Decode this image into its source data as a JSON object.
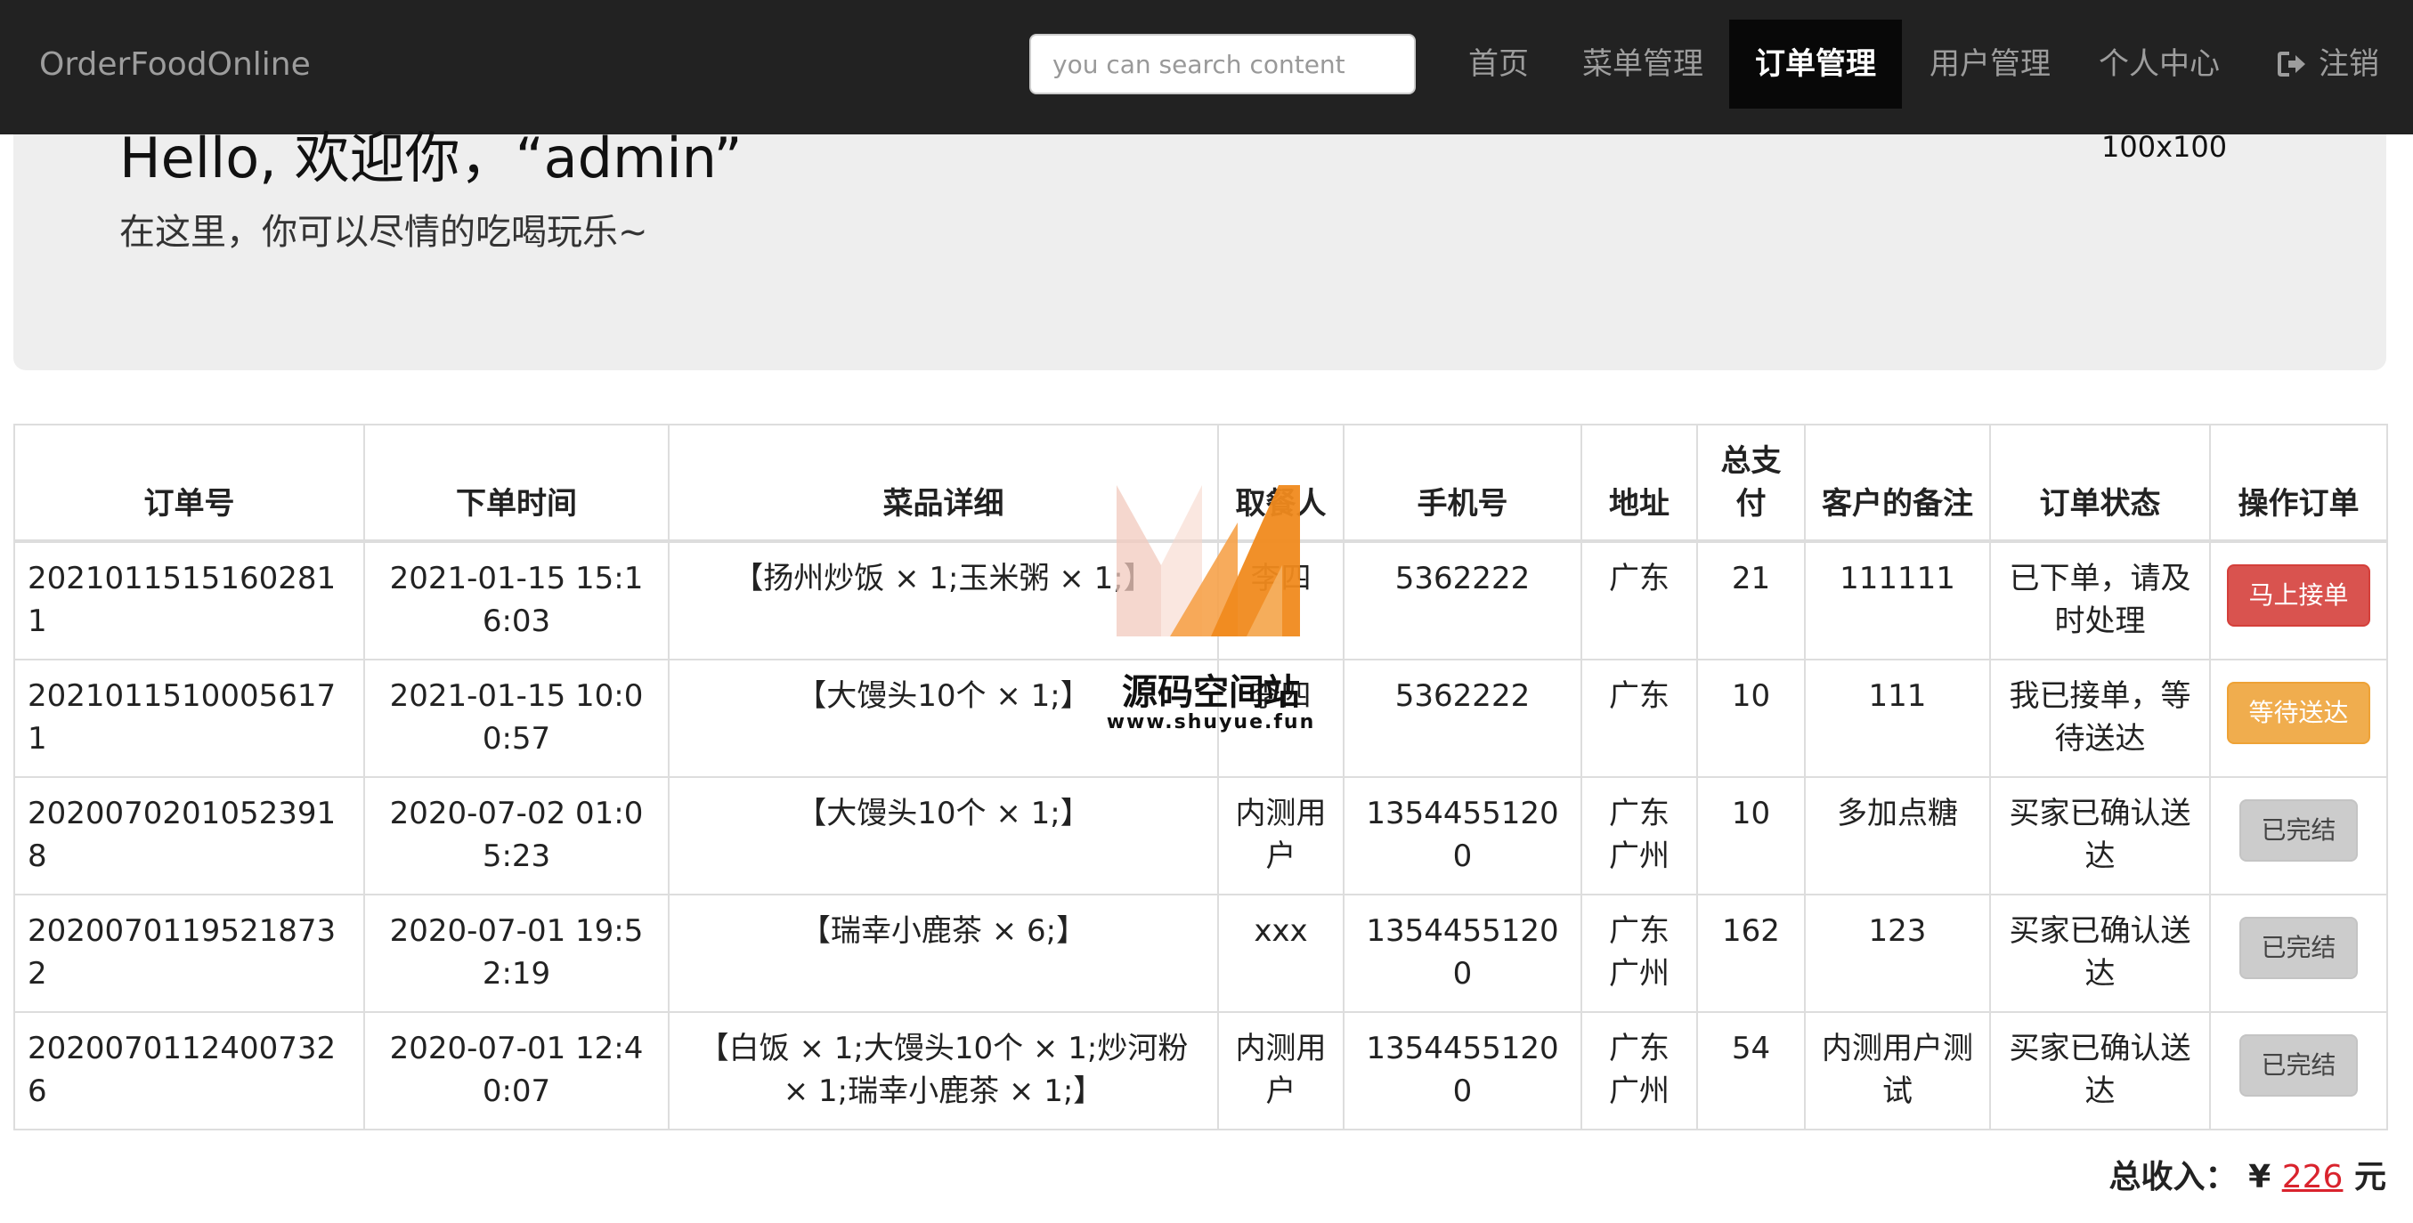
{
  "navbar": {
    "brand": "OrderFoodOnline",
    "search_placeholder": "you can search content",
    "items": [
      {
        "label": "首页"
      },
      {
        "label": "菜单管理"
      },
      {
        "label": "订单管理"
      },
      {
        "label": "用户管理"
      },
      {
        "label": "个人中心"
      },
      {
        "label": "注销"
      }
    ],
    "active": "订单管理",
    "logout_icon": "sign-out-icon"
  },
  "jumbotron": {
    "greeting": "Hello, 欢迎你，“admin”",
    "subtitle": "在这里，你可以尽情的吃喝玩乐~",
    "image_placeholder": "100x100"
  },
  "table": {
    "headers": [
      "订单号",
      "下单时间",
      "菜品详细",
      "取餐人",
      "手机号",
      "地址",
      "总支付",
      "客户的备注",
      "订单状态",
      "操作订单"
    ],
    "rows": [
      {
        "order_no": "20210115151602811",
        "time": "2021-01-15 15:16:03",
        "details": "【扬州炒饭 × 1;玉米粥 × 1;】",
        "receiver": "李四",
        "phone": "5362222",
        "address": "广东",
        "total": "21",
        "note": "111111",
        "status": "已下单，请及时处理",
        "action": "马上接单",
        "action_style": "danger"
      },
      {
        "order_no": "20210115100056171",
        "time": "2021-01-15 10:00:57",
        "details": "【大馒头10个 × 1;】",
        "receiver": "李四",
        "phone": "5362222",
        "address": "广东",
        "total": "10",
        "note": "111",
        "status": "我已接单，等待送达",
        "action": "等待送达",
        "action_style": "warning"
      },
      {
        "order_no": "20200702010523918",
        "time": "2020-07-02 01:05:23",
        "details": "【大馒头10个 × 1;】",
        "receiver": "内测用户",
        "phone": "13544551200",
        "address": "广东广州",
        "total": "10",
        "note": "多加点糖",
        "status": "买家已确认送达",
        "action": "已完结",
        "action_style": "default"
      },
      {
        "order_no": "20200701195218732",
        "time": "2020-07-01 19:52:19",
        "details": "【瑞幸小鹿茶 × 6;】",
        "receiver": "xxx",
        "phone": "13544551200",
        "address": "广东广州",
        "total": "162",
        "note": "123",
        "status": "买家已确认送达",
        "action": "已完结",
        "action_style": "default"
      },
      {
        "order_no": "20200701124007326",
        "time": "2020-07-01 12:40:07",
        "details": "【白饭 × 1;大馒头10个 × 1;炒河粉 × 1;瑞幸小鹿茶 × 1;】",
        "receiver": "内测用户",
        "phone": "13544551200",
        "address": "广东广州",
        "total": "54",
        "note": "内测用户测试",
        "status": "买家已确认送达",
        "action": "已完结",
        "action_style": "default"
      }
    ]
  },
  "summary": {
    "label": "总收入：",
    "currency": "¥",
    "amount": "226",
    "unit": "元"
  },
  "watermark": {
    "title": "源码空间站",
    "url": "www.shuyue.fun"
  },
  "colors": {
    "navbar_bg": "#222222",
    "nav_active_bg": "#080808",
    "jumbotron_bg": "#eeeeee",
    "danger": "#d9534f",
    "warning": "#f0ad4e",
    "default": "#cccccc",
    "amount": "#d9232d"
  }
}
